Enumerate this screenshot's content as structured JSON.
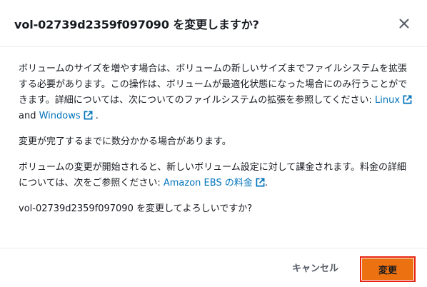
{
  "modal": {
    "title": "vol-02739d2359f097090 を変更しますか?",
    "close_icon": "close-icon"
  },
  "body": {
    "p1_text": "ボリュームのサイズを増やす場合は、ボリュームの新しいサイズまでファイルシステムを拡張する必要があります。この操作は、ボリュームが最適化状態になった場合にのみ行うことができます。詳細については、次についてのファイルシステムの拡張を参照してください: ",
    "p1_link_linux": "Linux",
    "p1_and": " and ",
    "p1_link_windows": "Windows",
    "p1_end": " .",
    "p2_text": "変更が完了するまでに数分かかる場合があります。",
    "p3_text": "ボリュームの変更が開始されると、新しいボリューム設定に対して課金されます。料金の詳細については、次をご参照ください: ",
    "p3_link": "Amazon EBS の料金",
    "p3_end": ".",
    "p4_text": "vol-02739d2359f097090 を変更してよろしいですか?",
    "external_link_icon": "external-link-icon"
  },
  "footer": {
    "cancel_label": "キャンセル",
    "modify_label": "変更"
  },
  "colors": {
    "link": "#0073bb",
    "primary_button": "#ec7211",
    "highlight_border": "#e8230e",
    "divider": "#eaeded"
  }
}
